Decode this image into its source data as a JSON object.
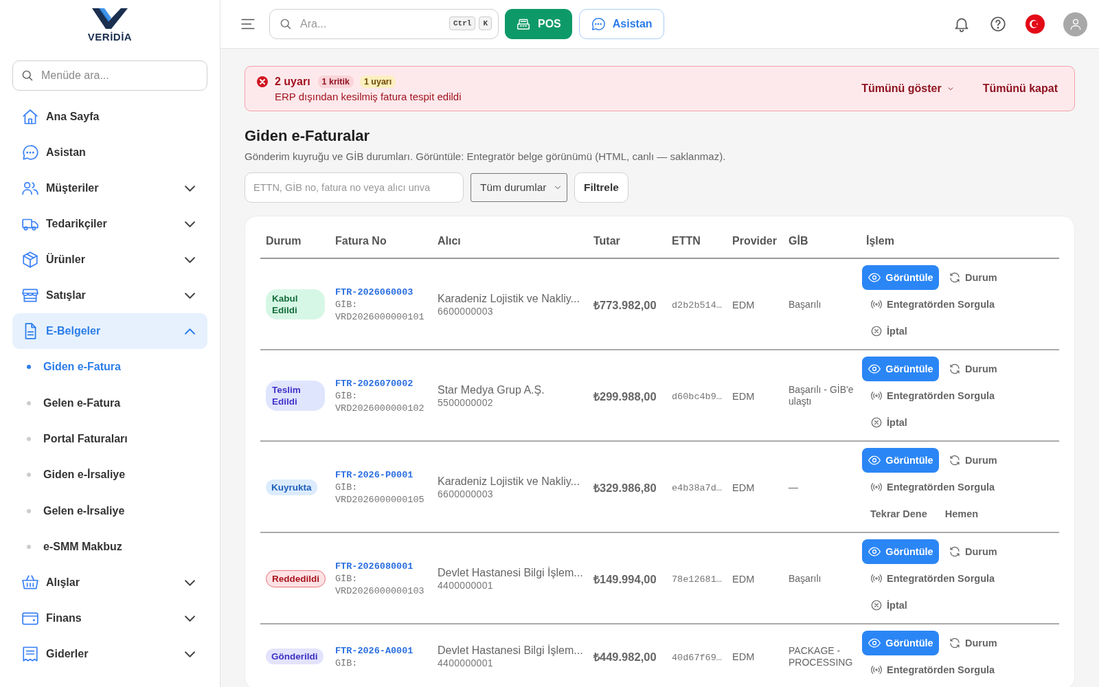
{
  "sidebar": {
    "logo": "VERİDİA",
    "search": {
      "placeholder": "Menüde ara..."
    },
    "items": [
      {
        "label": "Ana Sayfa",
        "kind": "link",
        "selected": false
      },
      {
        "label": "Asistan",
        "kind": "link",
        "selected": false
      },
      {
        "label": "Müşteriler",
        "kind": "group",
        "expanded": false,
        "selected": false
      },
      {
        "label": "Tedarikçiler",
        "kind": "group",
        "expanded": false,
        "selected": false
      },
      {
        "label": "Ürünler",
        "kind": "group",
        "expanded": false,
        "selected": false
      },
      {
        "label": "Satışlar",
        "kind": "group",
        "expanded": false,
        "selected": false
      },
      {
        "label": "E-Belgeler",
        "kind": "group",
        "expanded": true,
        "selected": true,
        "children": [
          {
            "label": "Giden e-Fatura",
            "selected": true
          },
          {
            "label": "Gelen e-Fatura",
            "selected": false
          },
          {
            "label": "Portal Faturaları",
            "selected": false
          },
          {
            "label": "Giden e-İrsaliye",
            "selected": false
          },
          {
            "label": "Gelen e-İrsaliye",
            "selected": false
          },
          {
            "label": "e-SMM Makbuz",
            "selected": false
          }
        ]
      },
      {
        "label": "Alışlar",
        "kind": "group",
        "expanded": false,
        "selected": false
      },
      {
        "label": "Finans",
        "kind": "group",
        "expanded": false,
        "selected": false
      },
      {
        "label": "Giderler",
        "kind": "group",
        "expanded": false,
        "selected": false
      }
    ]
  },
  "topbar": {
    "search": {
      "placeholder": "Ara...",
      "keys": [
        "Ctrl",
        "K"
      ]
    },
    "buttons": [
      {
        "label": "POS",
        "kind": "primary"
      },
      {
        "label": "Asistan",
        "kind": "outline"
      }
    ]
  },
  "alert": {
    "title": "2 uyarı",
    "badges": [
      {
        "label": "1 kritik",
        "kind": "critical"
      },
      {
        "label": "1 uyarı",
        "kind": "warning"
      }
    ],
    "message": "ERP dışından kesilmiş fatura tespit edildi",
    "actions": [
      {
        "label": "Tümünü göster",
        "kind": "dropdown"
      },
      {
        "label": "Tümünü kapat",
        "kind": "plain"
      }
    ]
  },
  "page": {
    "title": "Giden e-Faturalar",
    "subtitle": "Gönderim kuyruğu ve GİB durumları. Görüntüle: Entegratör belge görünümü (HTML, canlı — saklanmaz).",
    "filter": {
      "placeholder": "ETTN, GİB no, fatura no veya alıcı unva",
      "select": "Tüm durumlar",
      "button": "Filtrele"
    }
  },
  "table": {
    "columns": [
      "Durum",
      "Fatura No",
      "Alıcı",
      "Tutar",
      "ETTN",
      "Provider",
      "GİB",
      "İşlem"
    ],
    "rows": [
      {
        "status": {
          "label": "Kabul Edildi",
          "kind": "accepted"
        },
        "invoice_no": "FTR-2026060003",
        "gib_no": "GİB: VRD2026000000101",
        "recipient": "Karadeniz Lojistik ve Nakliy...",
        "tax_no": "6600000003",
        "amount": "₺773.982,00",
        "ettn": "d2b2b514…",
        "provider": "EDM",
        "gib_status": "Başarılı",
        "actions": [
          [
            {
              "label": "Görüntüle",
              "kind": "view"
            },
            {
              "label": "Durum",
              "kind": "refresh"
            }
          ],
          [
            {
              "label": "Entegratörden Sorgula",
              "kind": "query"
            }
          ],
          [
            {
              "label": "İptal",
              "kind": "cancel"
            }
          ]
        ]
      },
      {
        "status": {
          "label": "Teslim Edildi",
          "kind": "delivered"
        },
        "invoice_no": "FTR-2026070002",
        "gib_no": "GİB: VRD2026000000102",
        "recipient": "Star Medya Grup A.Ş.",
        "tax_no": "5500000002",
        "amount": "₺299.988,00",
        "ettn": "d60bc4b9…",
        "provider": "EDM",
        "gib_status": "Başarılı - GİB'e ulaştı",
        "actions": [
          [
            {
              "label": "Görüntüle",
              "kind": "view"
            },
            {
              "label": "Durum",
              "kind": "refresh"
            }
          ],
          [
            {
              "label": "Entegratörden Sorgula",
              "kind": "query"
            }
          ],
          [
            {
              "label": "İptal",
              "kind": "cancel"
            }
          ]
        ]
      },
      {
        "status": {
          "label": "Kuyrukta",
          "kind": "queued"
        },
        "invoice_no": "FTR-2026-P0001",
        "gib_no": "GİB: VRD2026000000105",
        "recipient": "Karadeniz Lojistik ve Nakliy...",
        "tax_no": "6600000003",
        "amount": "₺329.986,80",
        "ettn": "e4b38a7d…",
        "provider": "EDM",
        "gib_status": "—",
        "actions": [
          [
            {
              "label": "Görüntüle",
              "kind": "view"
            },
            {
              "label": "Durum",
              "kind": "refresh"
            }
          ],
          [
            {
              "label": "Entegratörden Sorgula",
              "kind": "query"
            }
          ],
          [
            {
              "label": "Tekrar Dene",
              "kind": "text"
            },
            {
              "label": "Hemen",
              "kind": "text"
            }
          ]
        ]
      },
      {
        "status": {
          "label": "Reddedildi",
          "kind": "rejected"
        },
        "invoice_no": "FTR-2026080001",
        "gib_no": "GİB: VRD2026000000103",
        "recipient": "Devlet Hastanesi Bilgi İşlem...",
        "tax_no": "4400000001",
        "amount": "₺149.994,00",
        "ettn": "78e12681…",
        "provider": "EDM",
        "gib_status": "Başarılı",
        "actions": [
          [
            {
              "label": "Görüntüle",
              "kind": "view"
            },
            {
              "label": "Durum",
              "kind": "refresh"
            }
          ],
          [
            {
              "label": "Entegratörden Sorgula",
              "kind": "query"
            }
          ],
          [
            {
              "label": "İptal",
              "kind": "cancel"
            }
          ]
        ]
      },
      {
        "status": {
          "label": "Gönderildi",
          "kind": "sent"
        },
        "invoice_no": "FTR-2026-A0001",
        "gib_no": "GİB:",
        "recipient": "Devlet Hastanesi Bilgi İşlem...",
        "tax_no": "4400000001",
        "amount": "₺449.982,00",
        "ettn": "40d67f69…",
        "provider": "EDM",
        "gib_status": "PACKAGE - PROCESSING",
        "actions": [
          [
            {
              "label": "Görüntüle",
              "kind": "view"
            },
            {
              "label": "Durum",
              "kind": "refresh"
            }
          ],
          [
            {
              "label": "Entegratörden Sorgula",
              "kind": "query"
            }
          ]
        ]
      }
    ]
  }
}
